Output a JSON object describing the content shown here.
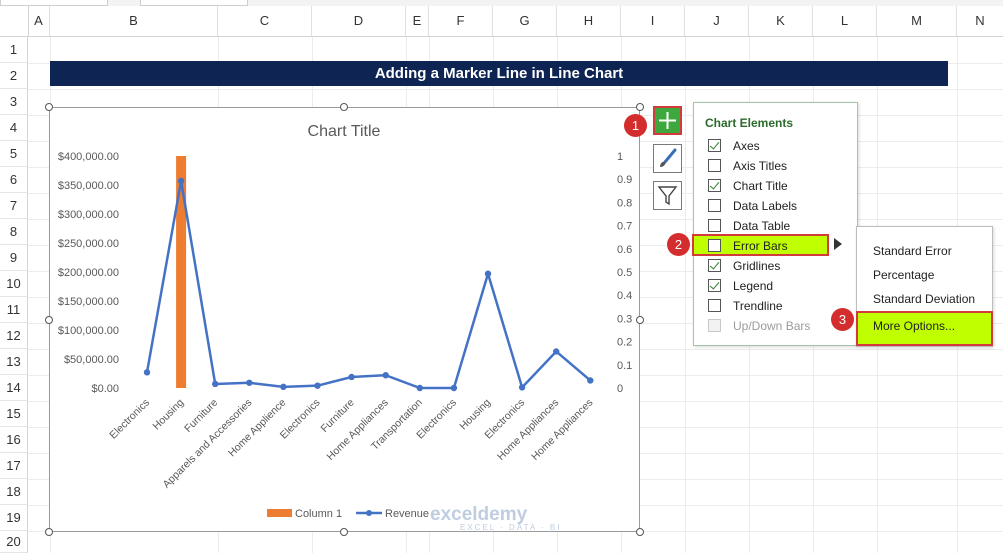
{
  "columns": [
    "A",
    "B",
    "C",
    "D",
    "E",
    "F",
    "G",
    "H",
    "I",
    "J",
    "K",
    "L",
    "M",
    "N"
  ],
  "rows": [
    "1",
    "2",
    "3",
    "4",
    "5",
    "6",
    "7",
    "8",
    "9",
    "10",
    "11",
    "12",
    "13",
    "14",
    "15",
    "16",
    "17",
    "18",
    "19",
    "20"
  ],
  "banner": {
    "title": "Adding a Marker Line in Line Chart"
  },
  "chart": {
    "title": "Chart Title",
    "legend": {
      "column1": "Column 1",
      "revenue": "Revenue"
    }
  },
  "chart_data": {
    "type": "line",
    "title": "Chart Title",
    "categories": [
      "Electronics",
      "Housing",
      "Furniture",
      "Apparels and Accessories",
      "Home Applience",
      "Electronics",
      "Furniture",
      "Home Appliances",
      "Transportation",
      "Electronics",
      "Housing",
      "Electronics",
      "Home Appliances",
      "Home Appliances"
    ],
    "series": [
      {
        "name": "Revenue",
        "axis": "primary",
        "values": [
          27000,
          357000,
          7000,
          9000,
          2000,
          4000,
          19000,
          22000,
          0,
          0,
          197000,
          1000,
          63000,
          13000
        ]
      },
      {
        "name": "Column 1",
        "type": "bar",
        "axis": "secondary",
        "values": [
          0,
          1,
          0,
          0,
          0,
          0,
          0,
          0,
          0,
          0,
          0,
          0,
          0,
          0
        ]
      }
    ],
    "y_ticks": [
      "$400,000.00",
      "$350,000.00",
      "$300,000.00",
      "$250,000.00",
      "$200,000.00",
      "$150,000.00",
      "$100,000.00",
      "$50,000.00",
      "$0.00"
    ],
    "y2_ticks": [
      "1",
      "0.9",
      "0.8",
      "0.7",
      "0.6",
      "0.5",
      "0.4",
      "0.3",
      "0.2",
      "0.1",
      "0"
    ],
    "ylim": [
      0,
      400000
    ],
    "y2lim": [
      0,
      1
    ],
    "legend_position": "bottom",
    "colors": {
      "revenue": "#4472c4",
      "column1": "#ed7d31"
    }
  },
  "chart_elements": {
    "title": "Chart Elements",
    "items": [
      {
        "label": "Axes",
        "checked": true
      },
      {
        "label": "Axis Titles",
        "checked": false
      },
      {
        "label": "Chart Title",
        "checked": true
      },
      {
        "label": "Data Labels",
        "checked": false
      },
      {
        "label": "Data Table",
        "checked": false
      },
      {
        "label": "Error Bars",
        "checked": false
      },
      {
        "label": "Gridlines",
        "checked": true
      },
      {
        "label": "Legend",
        "checked": true
      },
      {
        "label": "Trendline",
        "checked": false
      },
      {
        "label": "Up/Down Bars",
        "checked": false
      }
    ]
  },
  "error_bars_menu": {
    "items": [
      "Standard Error",
      "Percentage",
      "Standard Deviation",
      "More Options..."
    ]
  },
  "badges": [
    "1",
    "2",
    "3"
  ],
  "watermark": {
    "brand": "exceldemy",
    "tagline": "EXCEL · DATA · BI"
  },
  "icons": [
    "chart-elements-plus-icon",
    "chart-styles-brush-icon",
    "chart-filters-funnel-icon",
    "submenu-arrow-icon"
  ]
}
